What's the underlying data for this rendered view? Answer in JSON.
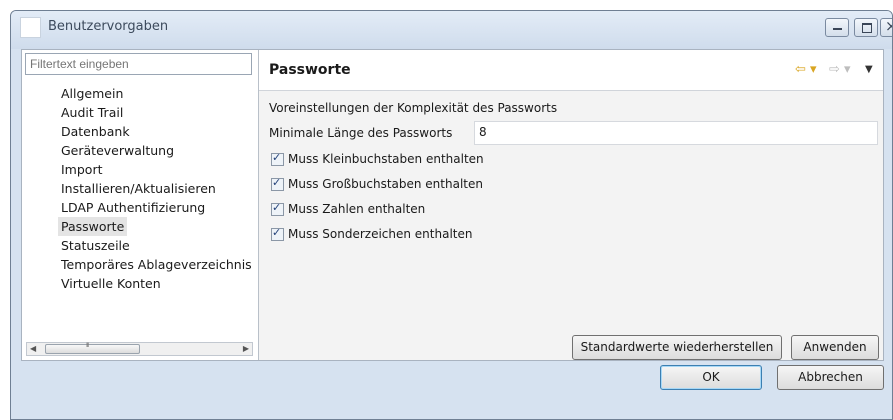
{
  "window": {
    "title": "Benutzervorgaben"
  },
  "left": {
    "filter_placeholder": "Filtertext eingeben",
    "tree_items": [
      "Allgemein",
      "Audit Trail",
      "Datenbank",
      "Geräteverwaltung",
      "Import",
      "Installieren/Aktualisieren",
      "LDAP Authentifizierung",
      "Passworte",
      "Statuszeile",
      "Temporäres Ablageverzeichnis",
      "Virtuelle Konten"
    ],
    "selected_item": "Passworte",
    "scrollbar_thumb_glyph": "III"
  },
  "page": {
    "title": "Passworte",
    "description": "Voreinstellungen der Komplexität des Passworts",
    "min_length_label": "Minimale Länge des Passworts",
    "min_length_value": "8",
    "checkboxes": [
      {
        "label": "Muss Kleinbuchstaben enthalten",
        "checked": true
      },
      {
        "label": "Muss Großbuchstaben enthalten",
        "checked": true
      },
      {
        "label": "Muss Zahlen enthalten",
        "checked": true
      },
      {
        "label": "Muss Sonderzeichen enthalten",
        "checked": true
      }
    ],
    "restore_label": "Standardwerte wiederherstellen",
    "apply_label": "Anwenden"
  },
  "footer": {
    "ok_label": "OK",
    "cancel_label": "Abbrechen"
  },
  "colors": {
    "titlebar": "#d6e2f0",
    "nav_back_arrow": "#d9a521",
    "default_button_border": "#3c7fb1"
  },
  "icons": [
    "back-arrow-icon",
    "forward-arrow-icon",
    "dropdown-icon",
    "minimize-icon",
    "maximize-icon",
    "close-icon",
    "checkbox-checked-icon"
  ]
}
